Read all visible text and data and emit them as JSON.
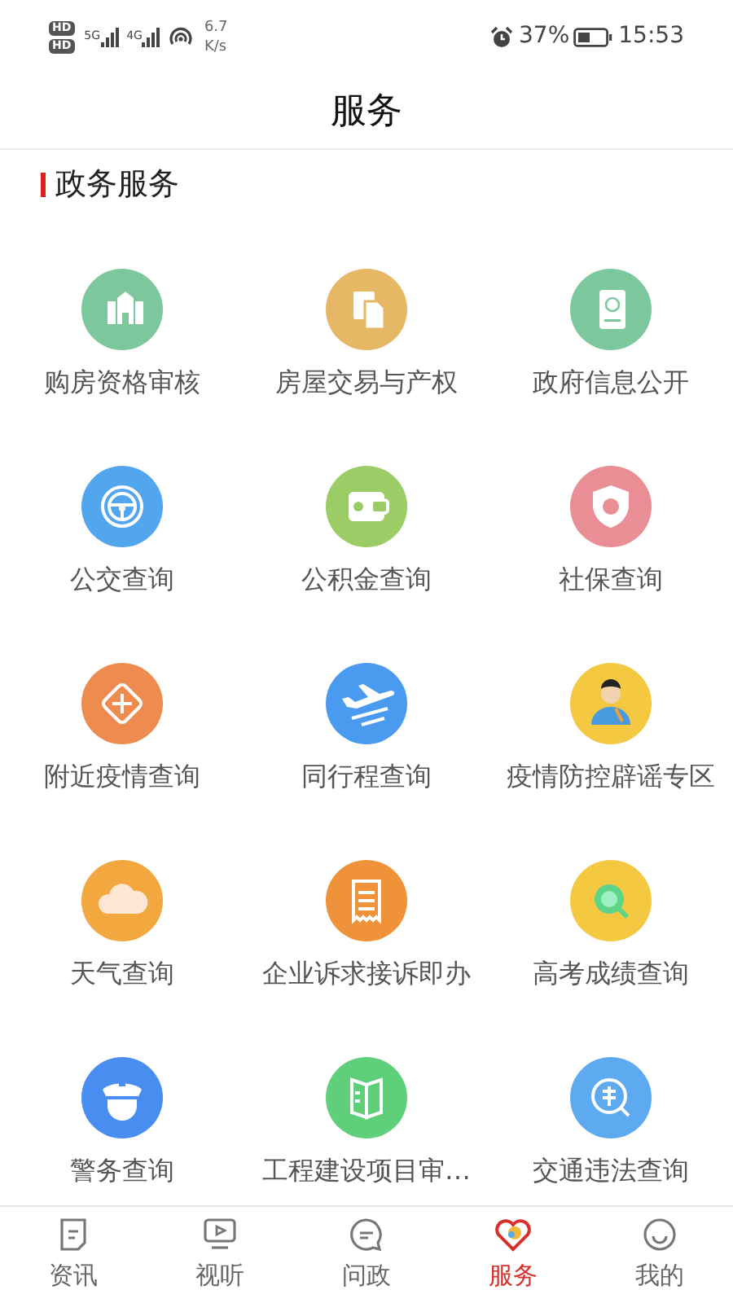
{
  "status_bar": {
    "sim_badges": [
      "HD",
      "HD"
    ],
    "networks": [
      "5G",
      "4G"
    ],
    "speed_value": "6.7",
    "speed_unit": "K/s",
    "battery": "37%",
    "time": "15:53"
  },
  "header": {
    "title": "服务"
  },
  "section": {
    "title": "政务服务"
  },
  "services": [
    {
      "label": "购房资格审核",
      "color": "#7cc79b"
    },
    {
      "label": "房屋交易与产权",
      "color": "#e6b765"
    },
    {
      "label": "政府信息公开",
      "color": "#7cc79b"
    },
    {
      "label": "公交查询",
      "color": "#52a6ee"
    },
    {
      "label": "公积金查询",
      "color": "#9ccc65"
    },
    {
      "label": "社保查询",
      "color": "#e98e94"
    },
    {
      "label": "附近疫情查询",
      "color": "#ee8c4f"
    },
    {
      "label": "同行程查询",
      "color": "#4a9af0"
    },
    {
      "label": "疫情防控辟谣专区",
      "color": "#f5c842"
    },
    {
      "label": "天气查询",
      "color": "#f2a73f"
    },
    {
      "label": "企业诉求接诉即办",
      "color": "#f0923a"
    },
    {
      "label": "高考成绩查询",
      "color": "#f5c842"
    },
    {
      "label": "警务查询",
      "color": "#4a8df0"
    },
    {
      "label": "工程建设项目审…",
      "color": "#5fcf7a"
    },
    {
      "label": "交通违法查询",
      "color": "#5eaaf0"
    }
  ],
  "tabs": [
    {
      "label": "资讯",
      "selected": false
    },
    {
      "label": "视听",
      "selected": false
    },
    {
      "label": "问政",
      "selected": false
    },
    {
      "label": "服务",
      "selected": true
    },
    {
      "label": "我的",
      "selected": false
    }
  ]
}
